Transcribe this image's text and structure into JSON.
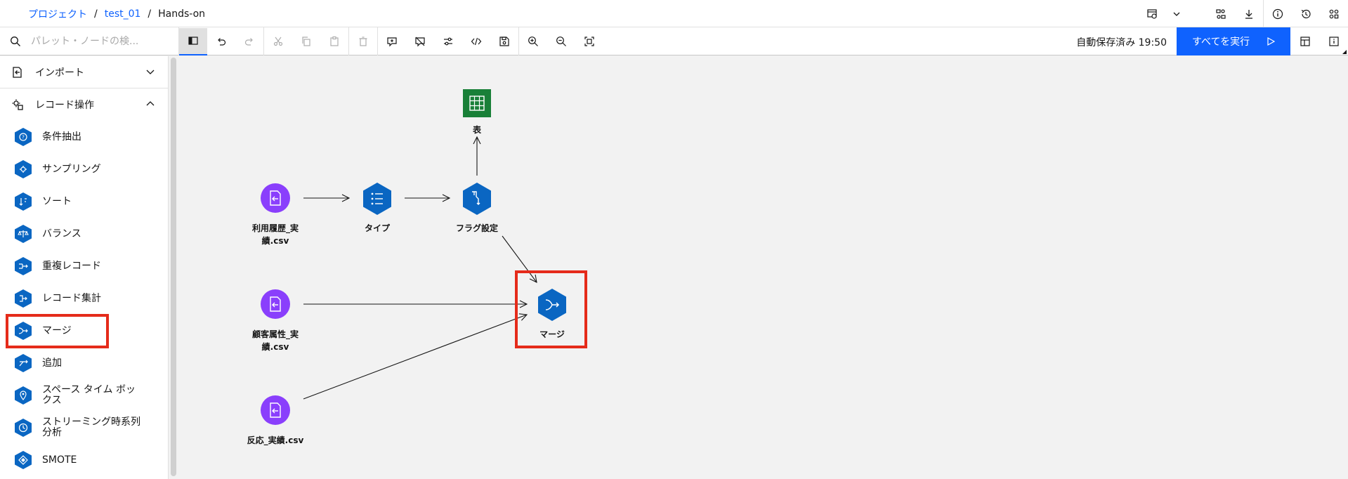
{
  "breadcrumb": {
    "project": "プロジェクト",
    "project_name": "test_01",
    "flow": "Hands-on",
    "sep": "/"
  },
  "toolbar": {
    "search_placeholder": "パレット・ノードの検...",
    "autosave": "自動保存済み 19:50",
    "run_all": "すべてを実行"
  },
  "sidebar": {
    "categories": [
      {
        "label": "インポート",
        "icon": "import-icon",
        "expanded": false
      },
      {
        "label": "レコード操作",
        "icon": "record-ops-icon",
        "expanded": true
      }
    ],
    "items": [
      {
        "label": "条件抽出",
        "icon": "select-icon"
      },
      {
        "label": "サンプリング",
        "icon": "sample-icon"
      },
      {
        "label": "ソート",
        "icon": "sort-icon"
      },
      {
        "label": "バランス",
        "icon": "balance-icon"
      },
      {
        "label": "重複レコード",
        "icon": "distinct-icon"
      },
      {
        "label": "レコード集計",
        "icon": "aggregate-icon"
      },
      {
        "label": "マージ",
        "icon": "merge-icon"
      },
      {
        "label": "追加",
        "icon": "append-icon"
      },
      {
        "label": "スペース タイム ボックス",
        "icon": "space-time-icon"
      },
      {
        "label": "ストリーミング時系列分析",
        "icon": "streaming-ts-icon"
      },
      {
        "label": "SMOTE",
        "icon": "smote-icon"
      }
    ]
  },
  "canvas": {
    "nodes": {
      "table": {
        "label": "表",
        "icon": "table-icon"
      },
      "usage": {
        "label": "利用履歴_実績.csv",
        "icon": "file-import-icon"
      },
      "type": {
        "label": "タイプ",
        "icon": "type-icon"
      },
      "flag": {
        "label": "フラグ設定",
        "icon": "set-to-flag-icon"
      },
      "customer": {
        "label": "顧客属性_実績.csv",
        "icon": "file-import-icon"
      },
      "merge": {
        "label": "マージ",
        "icon": "merge-icon"
      },
      "response": {
        "label": "反応_実績.csv",
        "icon": "file-import-icon"
      }
    }
  },
  "colors": {
    "accent": "#0f62fe",
    "node_blue": "#0f62fe",
    "hex_blue": "#0a66c2",
    "source_purple": "#8a3ffc",
    "output_green": "#198038",
    "highlight_red": "#e52b1a"
  }
}
